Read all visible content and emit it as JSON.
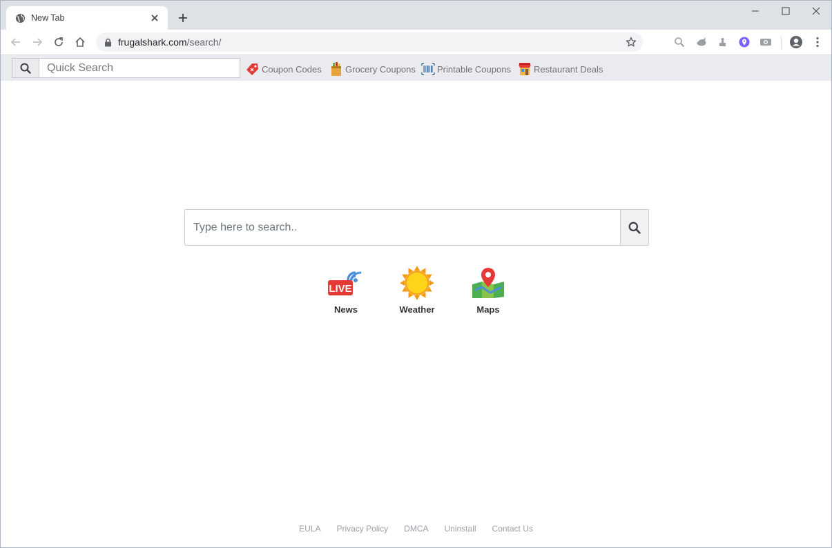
{
  "browser": {
    "tab_title": "New Tab",
    "url_host": "frugalshark.com",
    "url_path": "/search/"
  },
  "extbar": {
    "quick_search_placeholder": "Quick Search",
    "links": [
      {
        "label": "Coupon Codes",
        "icon": "price-tag-icon"
      },
      {
        "label": "Grocery Coupons",
        "icon": "grocery-bag-icon"
      },
      {
        "label": "Printable Coupons",
        "icon": "barcode-icon"
      },
      {
        "label": "Restaurant Deals",
        "icon": "restaurant-icon"
      }
    ]
  },
  "main": {
    "search_placeholder": "Type here to search..",
    "shortcuts": [
      {
        "label": "News",
        "icon": "live-news-icon"
      },
      {
        "label": "Weather",
        "icon": "sun-icon"
      },
      {
        "label": "Maps",
        "icon": "map-pin-icon"
      }
    ]
  },
  "footer": {
    "links": [
      "EULA",
      "Privacy Policy",
      "DMCA",
      "Uninstall",
      "Contact Us"
    ]
  },
  "colors": {
    "tabstrip": "#dee1e6",
    "extbar": "#e9ebee",
    "accent_red": "#e53935",
    "extension_purple": "#7b61ff"
  }
}
